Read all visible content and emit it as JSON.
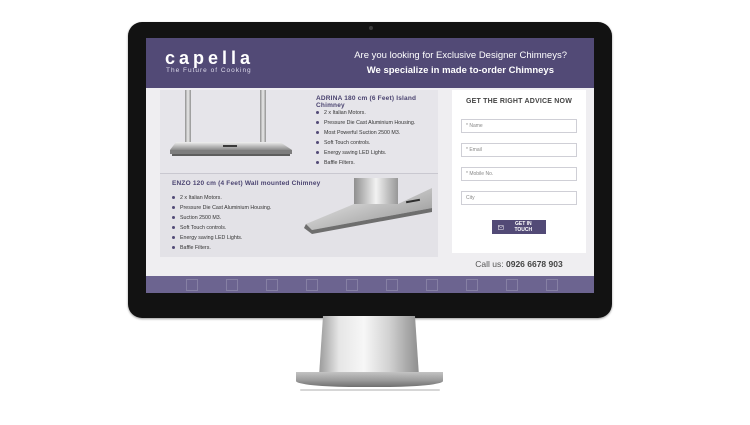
{
  "header": {
    "logo": "capella",
    "tagline": "The Future of Cooking",
    "headline_1": "Are you looking for Exclusive Designer Chimneys?",
    "headline_2": "We specialize in made to-order Chimneys"
  },
  "products": [
    {
      "title": "ADRINA 180 cm (6 Feet) Island Chimney",
      "features": [
        "2 x Italian Motors.",
        "Pressure Die Cast Aluminium Housing.",
        "Most Powerful Suction 2500 M3.",
        "Soft Touch controls.",
        "Energy saving LED Lights.",
        "Baffle Filters."
      ]
    },
    {
      "title": "ENZO 120 cm (4 Feet) Wall mounted Chimney",
      "features": [
        "2 x Italian Motors.",
        "Pressure Die Cast Aluminium Housing.",
        "Suction 2500 M3.",
        "Soft Touch controls.",
        "Energy saving LED Lights.",
        "Baffle Filters."
      ]
    }
  ],
  "form": {
    "title": "GET THE RIGHT ADVICE NOW",
    "name_placeholder": "* Name",
    "email_placeholder": "* Email",
    "mobile_placeholder": "* Mobile No.",
    "city_placeholder": "City",
    "submit_label": "GET IN TOUCH",
    "submit_icon": "envelope-icon"
  },
  "contact": {
    "label": "Call us:",
    "phone": "0926 6678 903"
  },
  "colors": {
    "brand": "#524a76",
    "footer": "#6c6490",
    "bezel": "#121212"
  }
}
